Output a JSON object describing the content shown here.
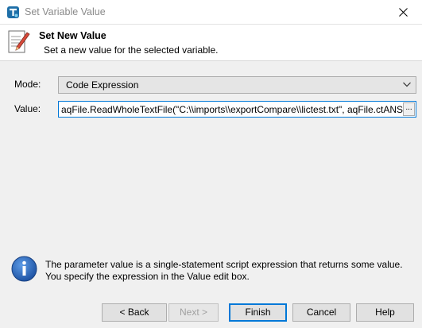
{
  "window": {
    "title": "Set Variable Value",
    "close_icon": "close-icon",
    "app_icon": "testcomplete-icon"
  },
  "header": {
    "icon": "edit-document-icon",
    "title": "Set New Value",
    "subtitle": "Set a new value for the selected variable."
  },
  "form": {
    "mode_label": "Mode:",
    "mode_value": "Code Expression",
    "value_label": "Value:",
    "value_text": "aqFile.ReadWholeTextFile(\"C:\\\\imports\\\\exportCompare\\\\lictest.txt\", aqFile.ctANSI)",
    "ellipsis_label": "..."
  },
  "info": {
    "icon": "info-icon",
    "text": "The parameter value is a single-statement script expression that returns some value. You specify the expression in the Value edit box."
  },
  "buttons": {
    "back": "< Back",
    "next": "Next >",
    "finish": "Finish",
    "cancel": "Cancel",
    "help": "Help"
  },
  "colors": {
    "accent": "#0078d7",
    "info_blue": "#1e5eb8"
  }
}
